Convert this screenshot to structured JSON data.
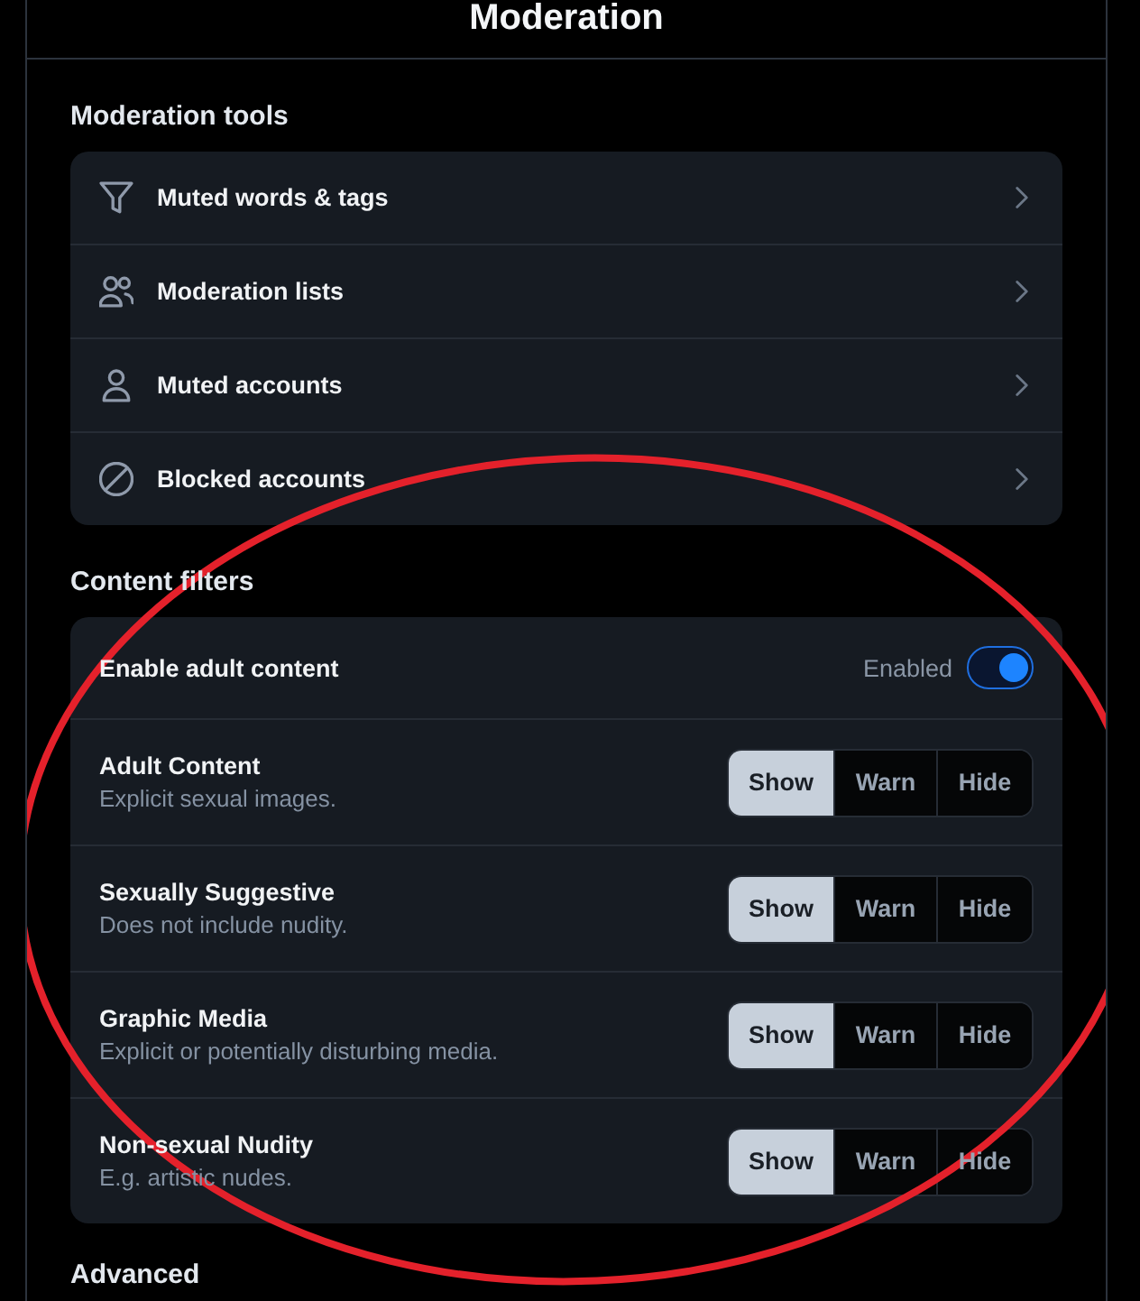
{
  "header": {
    "title": "Moderation"
  },
  "moderation_tools": {
    "heading": "Moderation tools",
    "items": [
      {
        "label": "Muted words & tags"
      },
      {
        "label": "Moderation lists"
      },
      {
        "label": "Muted accounts"
      },
      {
        "label": "Blocked accounts"
      }
    ]
  },
  "content_filters": {
    "heading": "Content filters",
    "adult_content": {
      "label": "Enable adult content",
      "status": "Enabled",
      "on": true
    },
    "filters": [
      {
        "title": "Adult Content",
        "description": "Explicit sexual images.",
        "options": [
          {
            "label": "Show",
            "selected": true
          },
          {
            "label": "Warn",
            "selected": false
          },
          {
            "label": "Hide",
            "selected": false
          }
        ]
      },
      {
        "title": "Sexually Suggestive",
        "description": "Does not include nudity.",
        "options": [
          {
            "label": "Show",
            "selected": true
          },
          {
            "label": "Warn",
            "selected": false
          },
          {
            "label": "Hide",
            "selected": false
          }
        ]
      },
      {
        "title": "Graphic Media",
        "description": "Explicit or potentially disturbing media.",
        "options": [
          {
            "label": "Show",
            "selected": true
          },
          {
            "label": "Warn",
            "selected": false
          },
          {
            "label": "Hide",
            "selected": false
          }
        ]
      },
      {
        "title": "Non-sexual Nudity",
        "description": "E.g. artistic nudes.",
        "options": [
          {
            "label": "Show",
            "selected": true
          },
          {
            "label": "Warn",
            "selected": false
          },
          {
            "label": "Hide",
            "selected": false
          }
        ]
      }
    ]
  },
  "advanced": {
    "heading": "Advanced"
  },
  "annotation": {
    "kind": "ellipse"
  }
}
